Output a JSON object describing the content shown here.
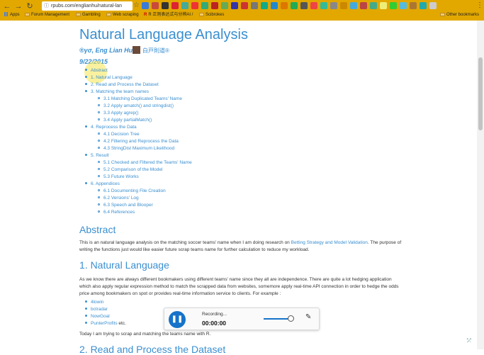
{
  "browser": {
    "url": "rpubs.com/englianhu/natural-lan",
    "bookmarks": [
      {
        "label": "Apps",
        "type": "apps"
      },
      {
        "label": "Forum Management",
        "type": "folder"
      },
      {
        "label": "Gambling",
        "type": "folder"
      },
      {
        "label": "Web scraping",
        "type": "folder"
      },
      {
        "label": "R 正则表达式与分辨AI /",
        "type": "site"
      },
      {
        "label": "Scibrokes",
        "type": "folder"
      },
      {
        "label": "Other bookmarks",
        "type": "folder"
      }
    ],
    "extension_colors": [
      "#3b7bd8",
      "#c84a3b",
      "#333",
      "#d23",
      "#4a9",
      "#e33",
      "#3a7",
      "#b22",
      "#6a5",
      "#33a",
      "#c33",
      "#777",
      "#1a8",
      "#28c",
      "#d70",
      "#2a5",
      "#555",
      "#e44",
      "#3b9",
      "#888",
      "#c80",
      "#4ad",
      "#b44",
      "#4a8",
      "#ee7",
      "#3c3",
      "#5bd",
      "#a73",
      "#2aa",
      "#ccc"
    ]
  },
  "doc": {
    "title": "Natural Language Analysis",
    "author": "®γσ, Eng Lian Hu",
    "author_cn": "白戸則道®",
    "date": "9/22/2015",
    "toc": [
      {
        "level": 1,
        "label": "Abstract"
      },
      {
        "level": 1,
        "label": "1. Natural Language"
      },
      {
        "level": 1,
        "label": "2. Read and Process the Dataset"
      },
      {
        "level": 1,
        "label": "3. Matching the team names"
      },
      {
        "level": 2,
        "label": "3.1 Matching Duplicated Teams' Name"
      },
      {
        "level": 2,
        "label": "3.2 Apply amatch() and stringdist()"
      },
      {
        "level": 2,
        "label": "3.3 Apply agrep()"
      },
      {
        "level": 2,
        "label": "3.4 Apply partialMatch()"
      },
      {
        "level": 1,
        "label": "4. Reprocess the Data"
      },
      {
        "level": 2,
        "label": "4.1 Decision Tree"
      },
      {
        "level": 2,
        "label": "4.2 Filtering and Reprocess the Data"
      },
      {
        "level": 2,
        "label": "4.3 StringDist Maximum Likelihood"
      },
      {
        "level": 1,
        "label": "5. Result"
      },
      {
        "level": 2,
        "label": "5.1 Checked and Filtered the Teams' Name"
      },
      {
        "level": 2,
        "label": "5.2 Comparison of the Model"
      },
      {
        "level": 2,
        "label": "5.3 Future Works"
      },
      {
        "level": 1,
        "label": "6. Appendices"
      },
      {
        "level": 2,
        "label": "6.1 Documenting File Creation"
      },
      {
        "level": 2,
        "label": "6.2 Versions' Log"
      },
      {
        "level": 2,
        "label": "6.3 Speech and Blooper"
      },
      {
        "level": 2,
        "label": "6.4 References"
      }
    ],
    "abstract_heading": "Abstract",
    "abstract_text_1": "This is an natural language analysis on the matching soccer teams' name when I am doing research on ",
    "abstract_link": "Betting Strategy and Model Validation",
    "abstract_text_2": ". The purpose of writing the functions just would like easier future scrap teams name for further calculation to reduce my workload.",
    "nl_heading": "1. Natural Language",
    "nl_text": "As we know there are always different bookmakers using different teams' name since they all are independence. There are quite a lot hedging application which also apply regular expression method to match the scrapped data from websites, somemore apply real-time API connection in order to hedge the odds price among bookmakers on spot or provides real-time information service to clients. For example :",
    "nl_list": [
      "4lowin",
      "bctradar",
      "NowGoal",
      "PunterProfits"
    ],
    "nl_list_etc": " etc.",
    "nl_text_2": "Today I am trying to scrap and matching the teams name with R.",
    "next_heading": "2. Read and Process the Dataset"
  },
  "recorder": {
    "status": "Recording...",
    "time": "00:00:00",
    "pause_icon": "pause-icon",
    "camera_icon": "webcam-icon",
    "pen_icon": "pen-icon"
  }
}
